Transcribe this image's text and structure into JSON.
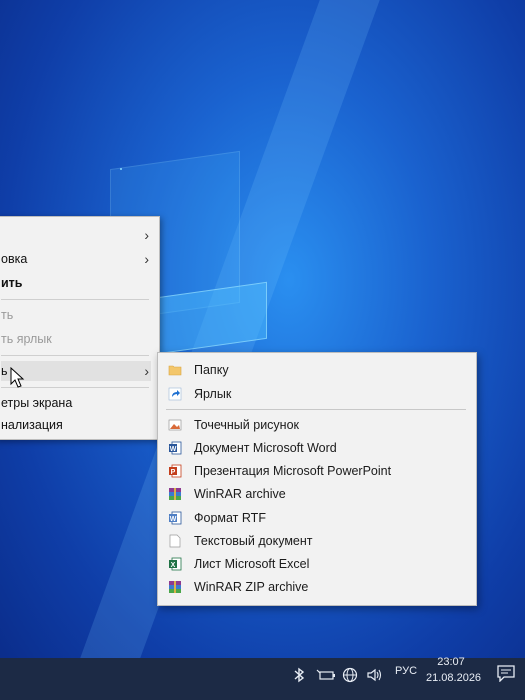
{
  "desktop": {
    "background": "Windows 10 blue wallpaper"
  },
  "context_menu": {
    "items": [
      {
        "label": "",
        "has_submenu": true
      },
      {
        "label": "овка",
        "has_submenu": true
      },
      {
        "label": "ить",
        "bold": true
      },
      {
        "label": "ть",
        "disabled": true
      },
      {
        "label": "ть ярлык",
        "disabled": true
      },
      {
        "label": "ь",
        "has_submenu": true,
        "highlighted": true
      },
      {
        "label": "етры экрана"
      },
      {
        "label": "нализация"
      }
    ]
  },
  "submenu": {
    "items": [
      {
        "label": "Папку",
        "icon": "folder-icon"
      },
      {
        "label": "Ярлык",
        "icon": "shortcut-icon"
      },
      {
        "label": "Точечный рисунок",
        "icon": "bitmap-icon"
      },
      {
        "label": "Документ Microsoft Word",
        "icon": "word-icon"
      },
      {
        "label": "Презентация Microsoft PowerPoint",
        "icon": "powerpoint-icon"
      },
      {
        "label": "WinRAR archive",
        "icon": "winrar-icon"
      },
      {
        "label": "Формат RTF",
        "icon": "rtf-icon"
      },
      {
        "label": "Текстовый документ",
        "icon": "text-doc-icon"
      },
      {
        "label": "Лист Microsoft Excel",
        "icon": "excel-icon"
      },
      {
        "label": "WinRAR ZIP archive",
        "icon": "winrar-zip-icon"
      }
    ]
  },
  "taskbar": {
    "language": "РУС",
    "time": "23:07",
    "date": "21.08.2026"
  },
  "colors": {
    "menu_bg": "#f2f2f2",
    "taskbar_bg": "#1c2a45",
    "accent": "#1a62cf"
  }
}
